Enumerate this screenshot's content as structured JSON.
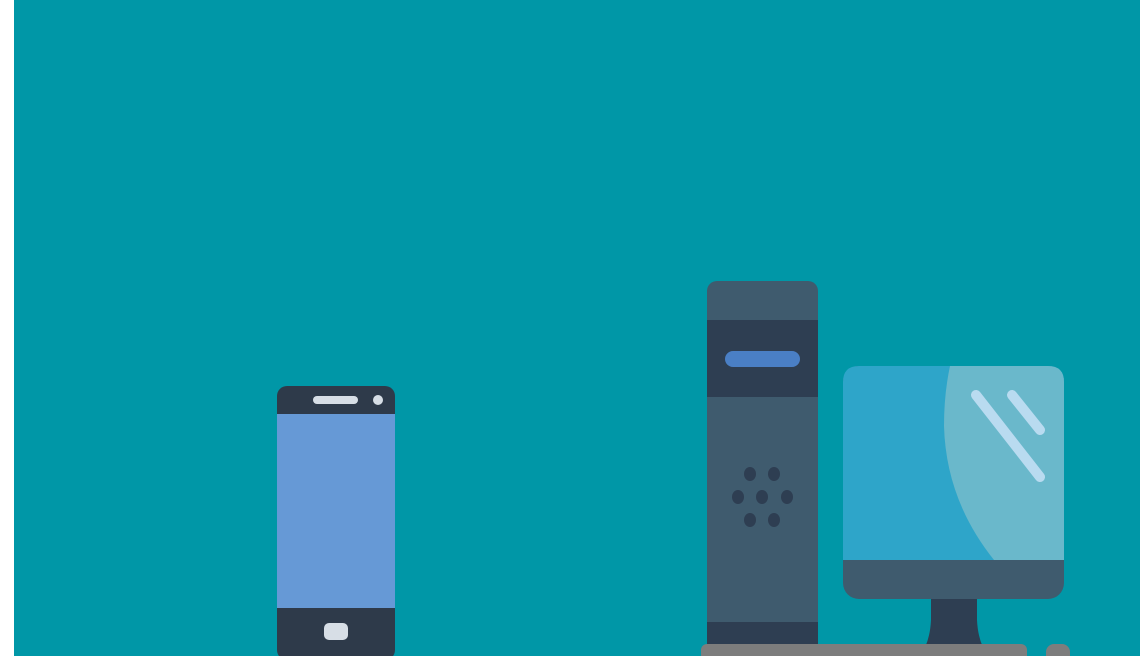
{
  "scene": {
    "background_color": "#0097A7",
    "phone": {
      "icon": "smartphone-icon",
      "body_color": "#2E3A4A",
      "screen_color": "#6699D6",
      "speaker_color": "#D7DEE6",
      "camera_color": "#D7DEE6",
      "home_button_color": "#D7DEE6"
    },
    "computer_tower": {
      "icon": "desktop-tower-icon",
      "body_color": "#3F5B6E",
      "panel_color": "#2E3E52",
      "drive_slot_color": "#4A7FC5",
      "speaker_dot_color": "#2E3E52"
    },
    "monitor": {
      "icon": "monitor-icon",
      "frame_color": "#3F5B6E",
      "screen_color": "#2EA5C9",
      "glare_color": "#6AB8CB",
      "reflection_color": "#B9DBF0",
      "stand_color": "#2E3E52"
    },
    "keyboard": {
      "icon": "keyboard-icon",
      "color": "#7D7D7D"
    },
    "mouse": {
      "icon": "mouse-icon",
      "color": "#7D7D7D"
    }
  }
}
